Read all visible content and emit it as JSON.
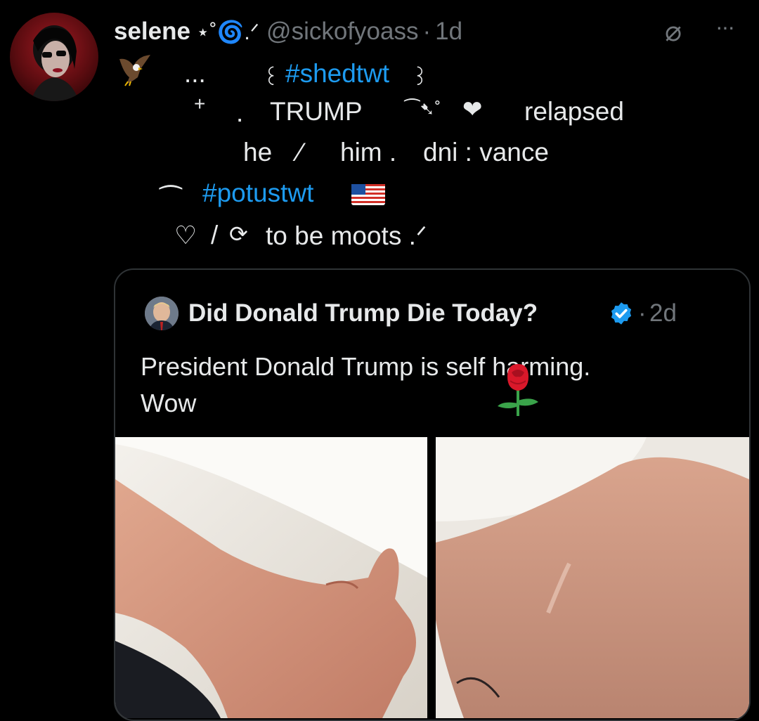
{
  "post": {
    "author": {
      "display_name": "selene",
      "name_decoration": "⋆˚🌀.ᐟ",
      "handle": "@sickofyoass",
      "separator": "·",
      "time": "1d"
    },
    "bio_lines": {
      "line1_dots": "...",
      "line1_open": "꒰",
      "line1_hashtag": "#shedtwt",
      "line1_close": "꒱",
      "line2_plus": "+",
      "line2_dot": ".",
      "line2_name": "TRUMP",
      "line2_deco": "⁀➷˚",
      "line2_heart": "❤",
      "line2_status": "relapsed",
      "line3_pronoun1": "he",
      "line3_slash": "⁄",
      "line3_pronoun2": "him .",
      "line3_dni": "dni : vance",
      "line4_arc": "⁀",
      "line4_hashtag": "#potustwt",
      "line5_heart": "♡",
      "line5_slash": "/",
      "line5_rt": "⟳",
      "line5_text": "to be moots .ᐟ"
    }
  },
  "quote": {
    "author_name": "Did Donald Trump Die Today?",
    "separator": "·",
    "time": "2d",
    "text_line1": "President Donald Trump is self harming.",
    "text_line2": "Wow"
  },
  "icons": {
    "grok": "grok-icon",
    "more": "more-icon",
    "verified": "verified-badge-icon",
    "rose": "rose-emoji",
    "flag": "us-flag-emoji",
    "eagle": "eagle-emoji"
  },
  "colors": {
    "background": "#000000",
    "text": "#e7e9ea",
    "muted": "#71767b",
    "link": "#1d9bf0",
    "border": "#2f3336"
  }
}
